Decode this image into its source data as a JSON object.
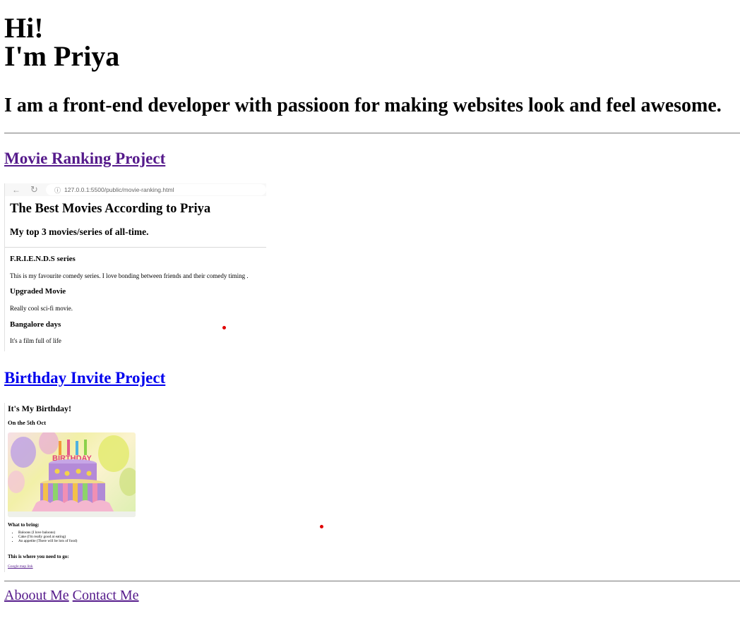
{
  "greeting": {
    "line1": "Hi!",
    "line2": "I'm Priya"
  },
  "tagline": "I am a front-end developer with passioon for making websites look and feel awesome.",
  "projects": {
    "movie": {
      "link_label": "Movie Ranking Project",
      "screenshot": {
        "url": "127.0.0.1:5500/public/movie-ranking.html",
        "title": "The Best Movies According to Priya",
        "subtitle": "My top 3 movies/series of all-time.",
        "items": [
          {
            "title": "F.R.I.E.N.D.S series",
            "desc": "This is my favourite comedy series. I love bonding between friends and their comedy timing ."
          },
          {
            "title": "Upgraded Movie",
            "desc": "Really cool sci-fi movie."
          },
          {
            "title": "Bangalore days",
            "desc": "It's a film full of life"
          }
        ]
      }
    },
    "birthday": {
      "link_label": "Birthday Invite Project",
      "screenshot": {
        "heading": "It's My Birthday!",
        "date": "On the 5th Oct",
        "bring_heading": "What to bring:",
        "bring_items": [
          "Baloons (I love baloons)",
          "Cake (I'm really good at eating)",
          "An appetite (There will be lots of food)"
        ],
        "where_heading": "This is where you need to go:",
        "map_link": "Google map link"
      }
    }
  },
  "footer": {
    "about": "Aboout Me",
    "contact": "Contact Me"
  },
  "colors": {
    "visited_link": "#551a8b",
    "unvisited_link": "#0000ee",
    "marker": "#e00000"
  },
  "icons": [
    "back-arrow-icon",
    "reload-icon",
    "info-icon",
    "birthday-cake-image"
  ]
}
